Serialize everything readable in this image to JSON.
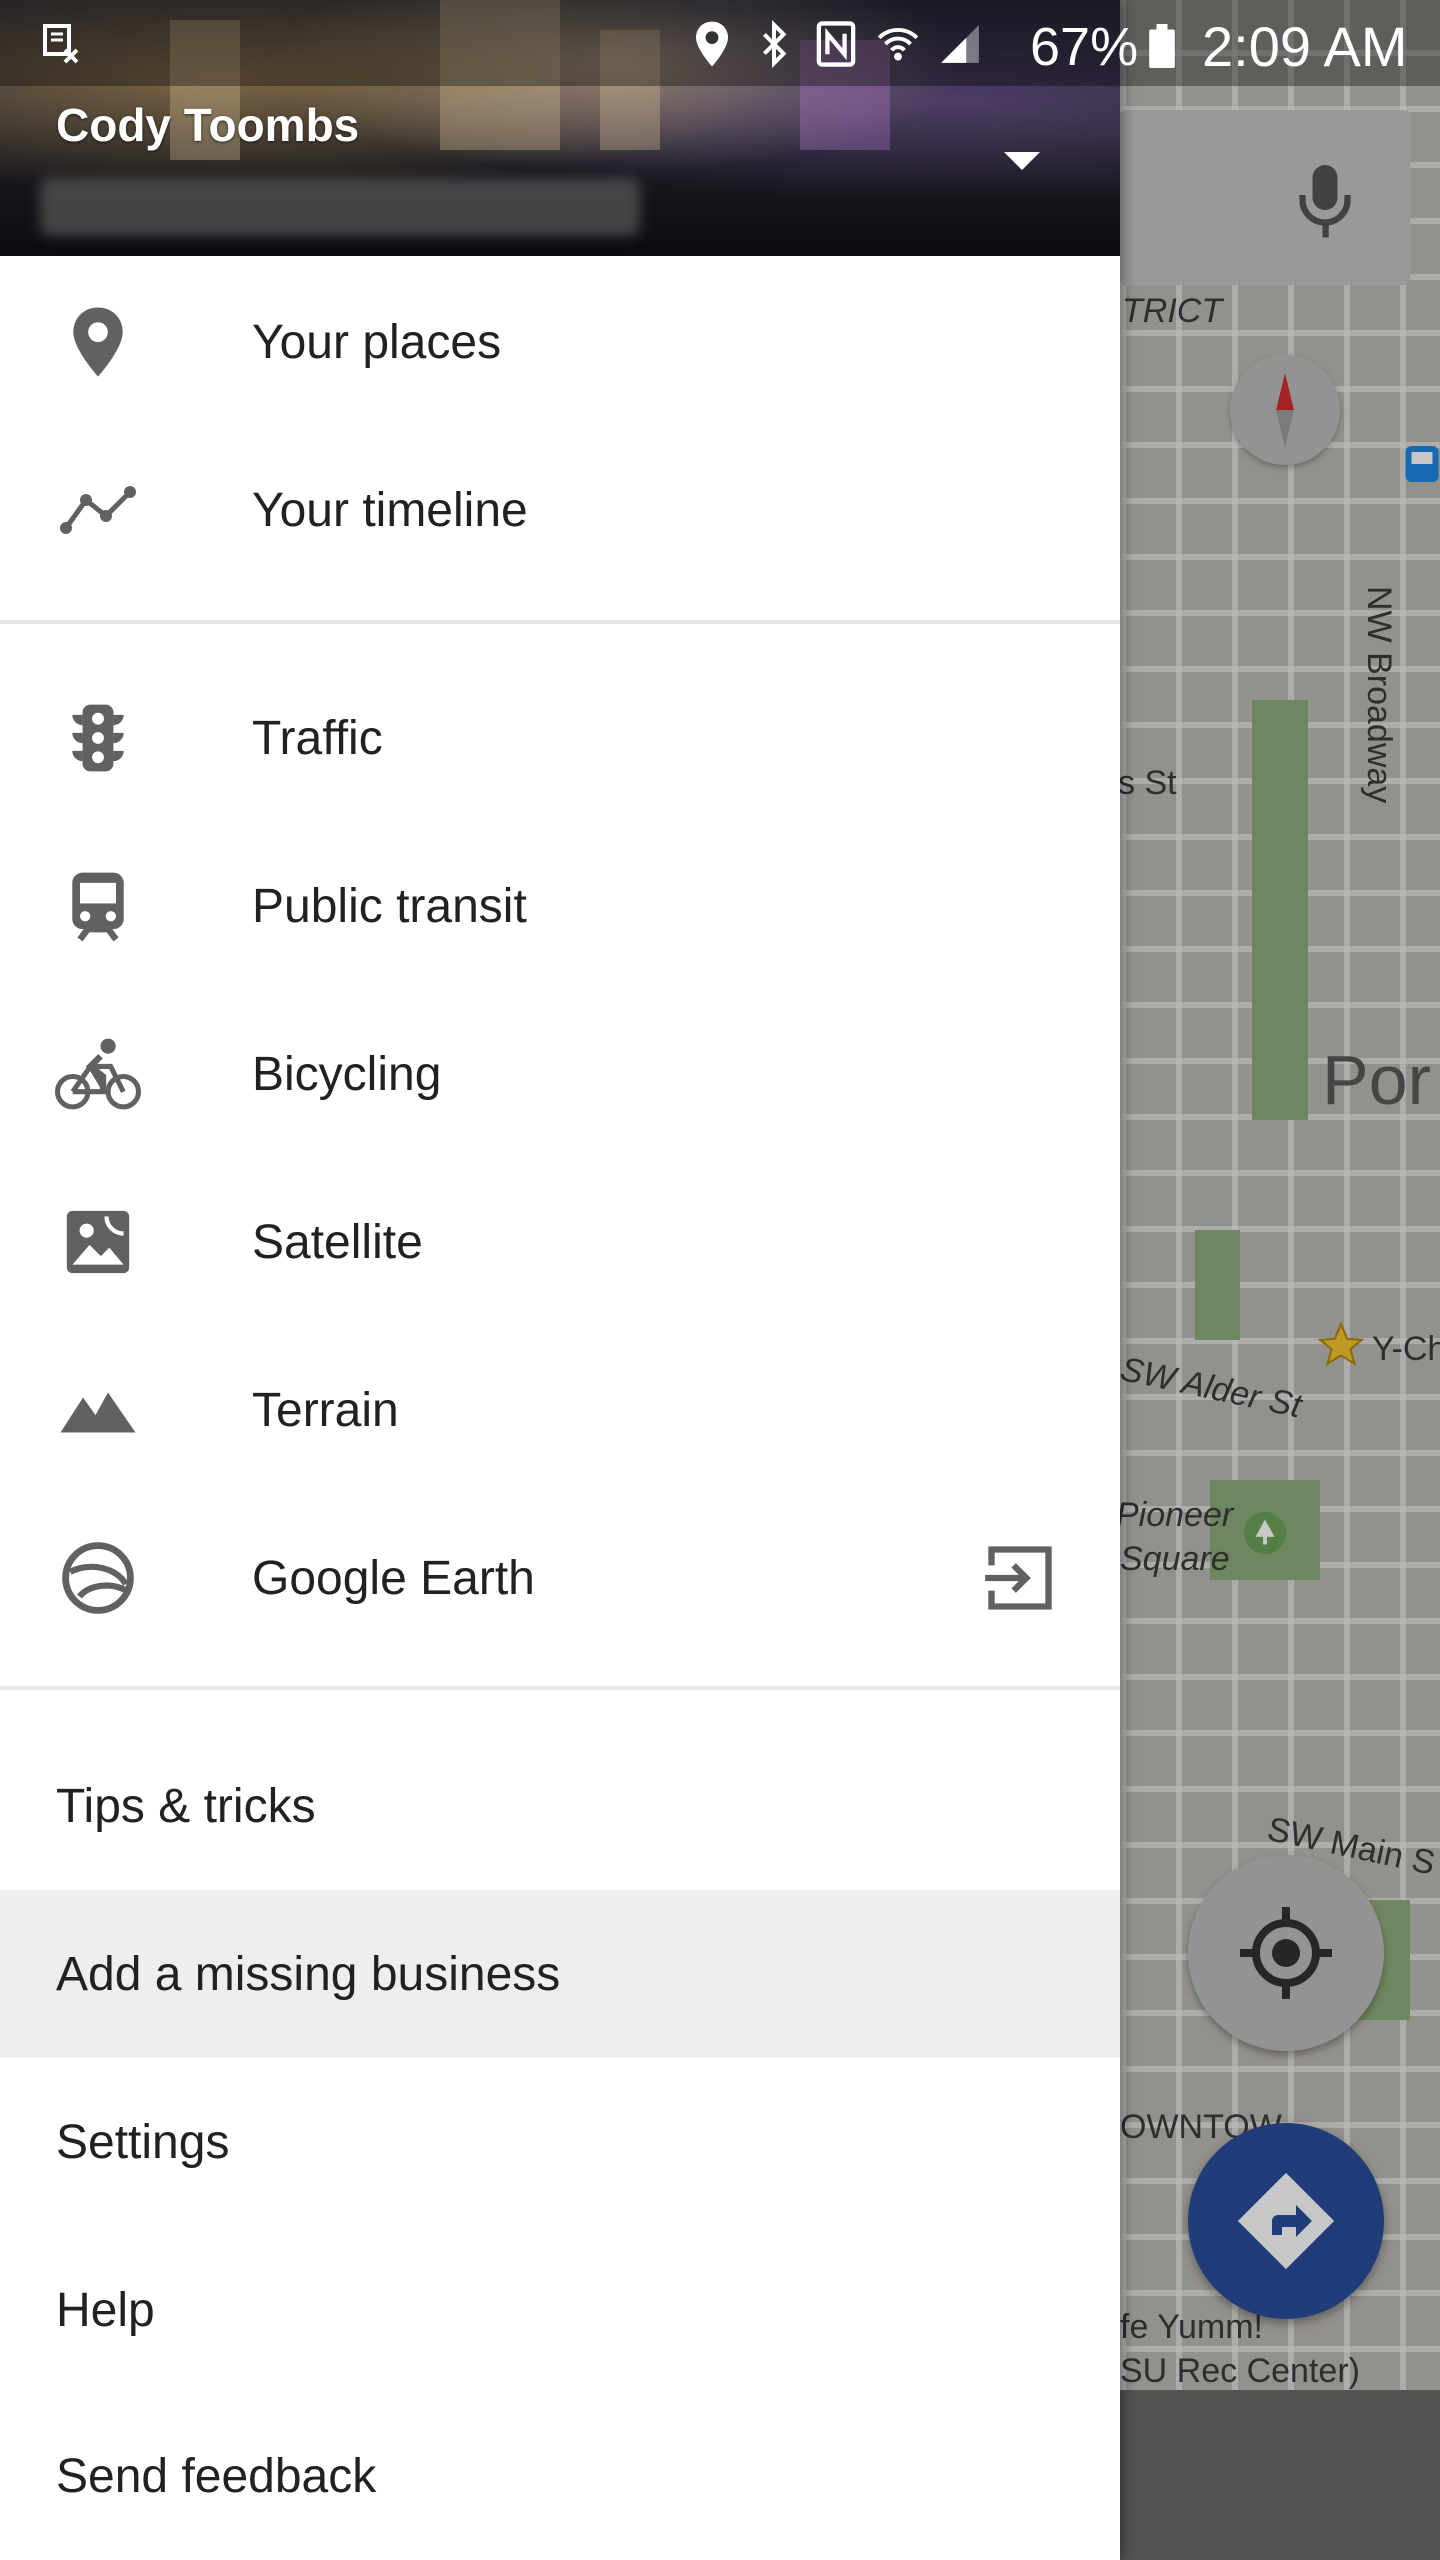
{
  "status_bar": {
    "battery_percent": "67%",
    "time": "2:09 AM",
    "icons": [
      "screenshot-icon",
      "location-icon",
      "bluetooth-icon",
      "nfc-icon",
      "wifi-icon",
      "signal-icon",
      "battery-icon"
    ]
  },
  "drawer": {
    "account_name": "Cody Toombs",
    "section1": [
      {
        "label": "Your places",
        "icon": "location-pin-icon"
      },
      {
        "label": "Your timeline",
        "icon": "timeline-icon"
      }
    ],
    "section2": [
      {
        "label": "Traffic",
        "icon": "traffic-light-icon"
      },
      {
        "label": "Public transit",
        "icon": "train-icon"
      },
      {
        "label": "Bicycling",
        "icon": "bicycle-icon"
      },
      {
        "label": "Satellite",
        "icon": "satellite-image-icon"
      },
      {
        "label": "Terrain",
        "icon": "terrain-mountain-icon"
      },
      {
        "label": "Google Earth",
        "icon": "google-earth-icon",
        "trailing_icon": "open-external-icon"
      }
    ],
    "section3": [
      {
        "label": "Tips & tricks"
      },
      {
        "label": "Add a missing business",
        "highlighted": true
      },
      {
        "label": "Settings"
      },
      {
        "label": "Help"
      },
      {
        "label": "Send feedback"
      }
    ]
  },
  "map": {
    "labels": [
      "TRICT",
      "NW Broadway",
      "s St",
      "Por",
      "Y-Ch",
      "SW Alder St",
      "Pioneer",
      "Square",
      "SW Main S",
      "OWNTOW",
      "fe Yumm!",
      "SU Rec Center)"
    ],
    "accent_color": "#2b4f9c"
  }
}
